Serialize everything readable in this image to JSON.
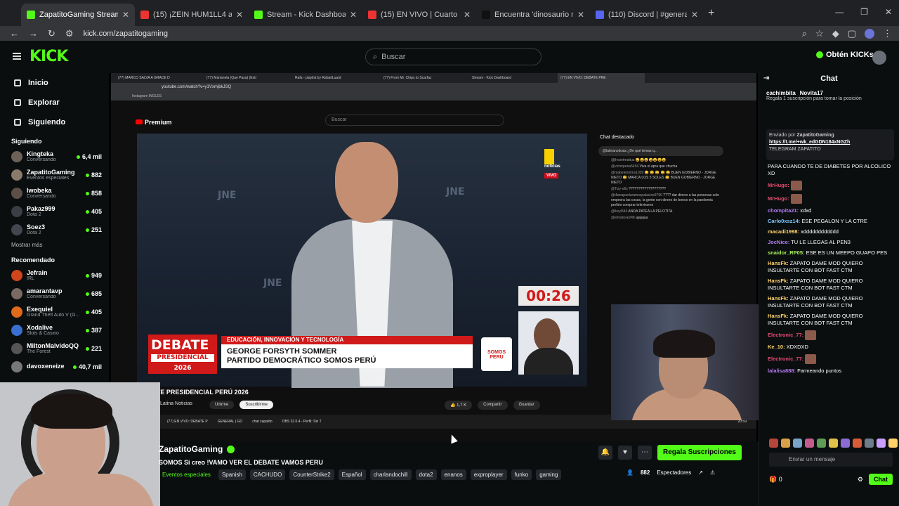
{
  "browser": {
    "tabs": [
      {
        "label": "ZapatitoGaming Stream - ",
        "fav": "#53fc18",
        "active": true
      },
      {
        "label": "(15) ¡ZEIN HUM1LL4 a BEB",
        "fav": "#e33",
        "active": false
      },
      {
        "label": "Stream - Kick Dashboard",
        "fav": "#53fc18",
        "active": false
      },
      {
        "label": "(15) EN VIVO | Cuarto deba",
        "fav": "#e33",
        "active": false
      },
      {
        "label": "Encuentra 'dinosaurio nada' en",
        "fav": "#111",
        "active": false
      },
      {
        "label": "(110) Discord | #general | L",
        "fav": "#5865f2",
        "active": false
      }
    ],
    "url": "kick.com/zapatitogaming"
  },
  "kick": {
    "logo": "KICK",
    "search_placeholder": "Buscar",
    "get_kicks": "Obtén KICKs"
  },
  "sidebar": {
    "nav": [
      "Inicio",
      "Explorar",
      "Siguiendo"
    ],
    "following_header": "Siguiendo",
    "following": [
      {
        "name": "Kingteka",
        "cat": "Conversando",
        "viewers": "6,4 mil",
        "color": "#6d6257"
      },
      {
        "name": "ZapatitoGaming",
        "cat": "Eventos especiales",
        "viewers": "882",
        "color": "#8a7a6a"
      },
      {
        "name": "Iwobeka",
        "cat": "Conversando",
        "viewers": "858",
        "color": "#5c4f47"
      },
      {
        "name": "Pakaz999",
        "cat": "Dota 2",
        "viewers": "405",
        "color": "#3b3e45"
      },
      {
        "name": "Soez3",
        "cat": "Dota 2",
        "viewers": "251",
        "color": "#43464f"
      }
    ],
    "show_more": "Mostrar más",
    "recommended_header": "Recomendado",
    "recommended": [
      {
        "name": "Jefrain",
        "cat": "IRL",
        "viewers": "949",
        "color": "#d0451b"
      },
      {
        "name": "amarantavp",
        "cat": "Conversando",
        "viewers": "685",
        "color": "#7b6a62"
      },
      {
        "name": "Exequiel",
        "cat": "Grand Theft Auto V (G...",
        "viewers": "405",
        "color": "#e06a1a"
      },
      {
        "name": "Xodalive",
        "cat": "Slots & Casino",
        "viewers": "387",
        "color": "#3a6fd0"
      },
      {
        "name": "MiltonMalvidoQQ",
        "cat": "The Forest",
        "viewers": "221",
        "color": "#555"
      },
      {
        "name": "davoxeneize",
        "cat": "",
        "viewers": "40,7 mil",
        "color": "#777"
      }
    ]
  },
  "youtube": {
    "inner_tabs": [
      "(77) MARCO SALVA A GRACE D",
      "(77) Marianela (Que Pasa) (Extr",
      "Rafa - playlist by RafaelLuard",
      "(77) From Mr. Chips to Scarfac",
      "Stream - Kick Dashboard",
      "(77) EN VIVO: DEBATE PRE"
    ],
    "inner_url": "youtube.com/watch?v=y1VxmjbkJSQ",
    "bookmarks": "Instagram    INGLES",
    "logo": "Premium",
    "search": "Buscar",
    "timer": "00:26",
    "noticias": "noticias",
    "vivo": "VIVO",
    "debate": "DEBATE",
    "debate_sub": "PRESIDENCIAL",
    "debate_year": "2026",
    "lower_tag": "EDUCACIÓN, INNOVACIÓN Y TECNOLOGÍA",
    "lower_name": "GEORGE FORSYTH SOMMER",
    "lower_party": "PARTIDO DEMOCRÁTICO SOMOS PERÚ",
    "somos": "SOMOS PERU",
    "chat_title": "Chat destacado",
    "chat_pin": "@latinanoticias  ¿De qué temas q...",
    "chat_msgs": [
      {
        "u": "@jhosetmattuz",
        "t": "😀😀😀😀😀😀😀"
      },
      {
        "u": "@victorpena5454",
        "t": "Viva el apra que chucha"
      },
      {
        "u": "@mabelenmms1039",
        "t": "😀 😀 😀 😀 😀 BUEN GOBIERNO - JORGE NIETO 😀 MARCA LOS 5 SOLES 😀 BUEN GOBIERNO - JORGE NIETO"
      },
      {
        "u": "@Tizy-o6s",
        "t": "???????????????????"
      },
      {
        "u": "@dianapaolaramospalacios9790",
        "t": "???? dar dinero a las personas solo empeora las cosas, la gente con dinero de bonos en la pandemia prefirio comprar televisores"
      },
      {
        "u": "@lkoyl546",
        "t": "ANDA PATEA LA PELOTITA"
      },
      {
        "u": "@elmatose248",
        "t": "ajajajaa"
      }
    ],
    "video_title": "DEBATE PRESIDENCIAL PERÚ 2026",
    "channel": "Latina Noticias",
    "join": "Unirme",
    "subscribe": "Suscribirme",
    "likes": "1,7 K",
    "share": "Compartir",
    "save": "Guardar",
    "taskbar": [
      "(77) EN VIVO: DEBATE P",
      "GENERAL | GO",
      "chat zapatito",
      "OBS 32.0.4 - Perfil: Sin T"
    ],
    "clock": "20:59"
  },
  "stream": {
    "name": "ZapatitoGaming",
    "title": "SOMOS Si creo !VAMO VER EL DEBATE VAMOS PERU",
    "category": "Eventos especiales",
    "tags": [
      "Spanish",
      "CACHUDO",
      "CounterStrike2",
      "Español",
      "charlandochill",
      "dota2",
      "enanos",
      "exproplayer",
      "funko",
      "gaming"
    ],
    "gift": "Regala Suscripciones",
    "viewers": "882",
    "viewers_label": "Espectadores"
  },
  "chat": {
    "title": "Chat",
    "top_user": "cachimbita",
    "sub_user": "Novita17",
    "sub_text": "Regala 1 suscripción para tomar la posición",
    "pinned_by": "Enviado por",
    "pinned_user": "ZapatitoGaming",
    "pinned_link": "https://t.me/+wk_edGDN184xNGZh",
    "pinned_text": "TELEGRAM ZAPATITO",
    "messages": [
      {
        "u": "",
        "color": "#fff",
        "t": "PARA CUANDO TE DE DIABETES POR ALCOLICO XD",
        "emote": false
      },
      {
        "u": "MrHugo:",
        "color": "#e34c72",
        "t": "",
        "emote": true
      },
      {
        "u": "MrHugo:",
        "color": "#e34c72",
        "t": "",
        "emote": true
      },
      {
        "u": "chompita21:",
        "color": "#b57cf2",
        "t": "xdxd",
        "emote": false
      },
      {
        "u": "Carlo0xsz14:",
        "color": "#7ec8ff",
        "t": "ESE PEGALON Y LA CTRE",
        "emote": false
      },
      {
        "u": "macadi1998:",
        "color": "#ffd36a",
        "t": "xdddddddddddd",
        "emote": false
      },
      {
        "u": "JocNice:",
        "color": "#b57cf2",
        "t": "TU LE LLEGAS AL PEN3",
        "emote": false
      },
      {
        "u": "snaidor_RP05:",
        "color": "#a8f25c",
        "t": "ESE ES UN MEEPO GUAPO PES",
        "emote": false
      },
      {
        "u": "HansFk:",
        "color": "#ffd36a",
        "t": "ZAPATO DAME MOD QUIERO INSULTARTE CON BOT FAST CTM",
        "emote": false
      },
      {
        "u": "HansFk:",
        "color": "#ffd36a",
        "t": "ZAPATO DAME MOD QUIERO INSULTARTE CON BOT FAST CTM",
        "emote": false
      },
      {
        "u": "HansFk:",
        "color": "#ffd36a",
        "t": "ZAPATO DAME MOD QUIERO INSULTARTE CON BOT FAST CTM",
        "emote": false
      },
      {
        "u": "HansFk:",
        "color": "#ffd36a",
        "t": "ZAPATO DAME MOD QUIERO INSULTARTE CON BOT FAST CTM",
        "emote": false
      },
      {
        "u": "Electronic_77:",
        "color": "#e34c72",
        "t": "",
        "emote": true
      },
      {
        "u": "Ke_10:",
        "color": "#ffd36a",
        "t": "XDXDXD",
        "emote": false
      },
      {
        "u": "Electronic_77:",
        "color": "#e34c72",
        "t": "",
        "emote": true
      },
      {
        "u": "lalalisa888:",
        "color": "#b57cf2",
        "t": "Farmeando puntos",
        "emote": false
      }
    ],
    "input_placeholder": "Enviar un mensaje",
    "points": "0",
    "send": "Chat"
  }
}
